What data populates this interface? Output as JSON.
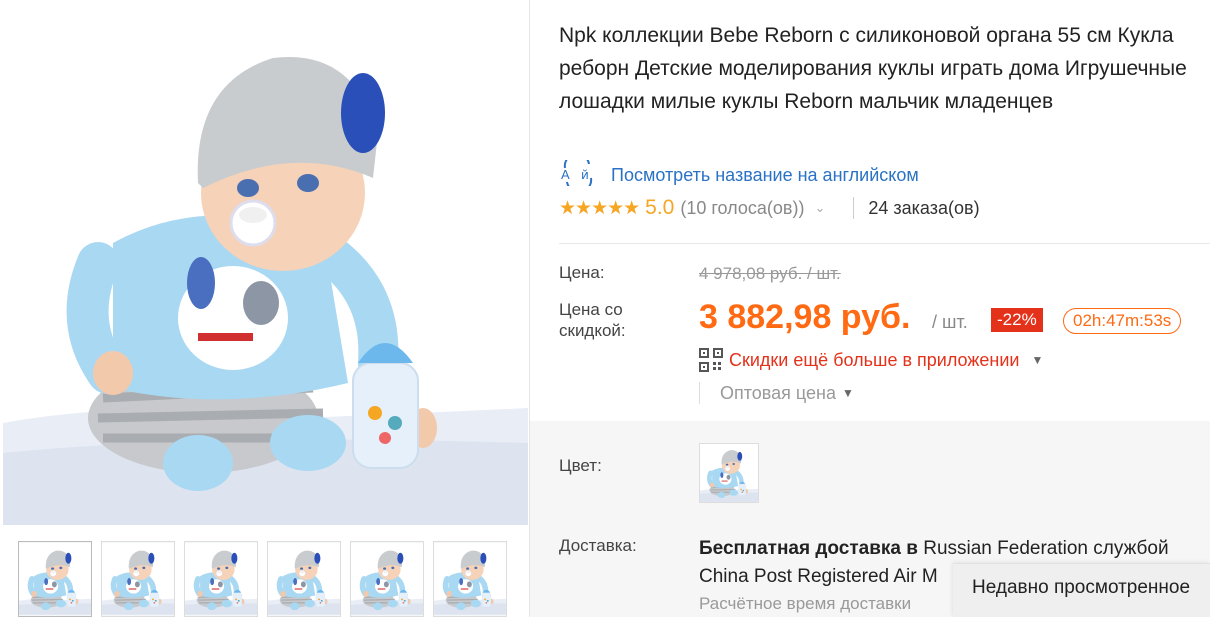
{
  "product": {
    "title": "Npk коллекции Bebe Reborn с силиконовой органа 55 см Кукла реборн Детские моделирования куклы играть дома Игрушечные лошадки милые куклы Reborn мальчик младенцев",
    "translate_link": "Посмотреть название на английском",
    "translate_icon": "translate-icon",
    "rating": {
      "stars": "★★★★★",
      "value": "5.0",
      "votes": "(10 голоса(ов))",
      "orders": "24 заказа(ов)"
    }
  },
  "price": {
    "price_label": "Цена:",
    "old_price": "4 978,08 руб. / шт.",
    "discount_label": "Цена со скидкой:",
    "new_price": "3 882,98 руб.",
    "per_unit": "/ шт.",
    "discount_badge": "-22%",
    "timer": "02h:47m:53s",
    "app_discount": "Скидки ещё больше в приложении",
    "wholesale": "Оптовая цена"
  },
  "options": {
    "color_label": "Цвет:",
    "shipping_label": "Доставка:",
    "shipping_free": "Бесплатная доставка в",
    "shipping_country": "Russian Federation",
    "shipping_service": "службой China Post Registered Air M",
    "shipping_estimate": "Расчётное время доставки"
  },
  "recently_viewed": "Недавно просмотренное",
  "colors": {
    "accent": "#ff6a13",
    "discount": "#e4311a",
    "star": "#f5a623",
    "link": "#2a72c4",
    "doll_blue": "#a9d8f2",
    "hat_gray": "#c9cccf"
  },
  "gallery": {
    "thumbnail_count": 6
  }
}
